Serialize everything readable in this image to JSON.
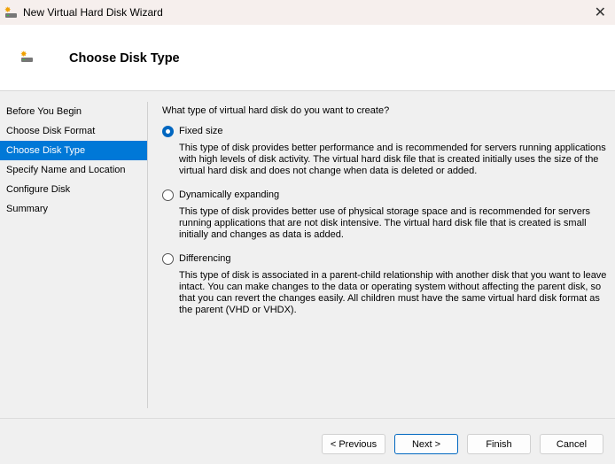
{
  "window": {
    "title": "New Virtual Hard Disk Wizard",
    "close": "✕"
  },
  "header": {
    "title": "Choose Disk Type"
  },
  "nav": {
    "items": [
      "Before You Begin",
      "Choose Disk Format",
      "Choose Disk Type",
      "Specify Name and Location",
      "Configure Disk",
      "Summary"
    ],
    "selected": "Choose Disk Type"
  },
  "main": {
    "question": "What type of virtual hard disk do you want to create?",
    "options": [
      {
        "label": "Fixed size",
        "checked": true,
        "description": "This type of disk provides better performance and is recommended for servers running applications with high levels of disk activity. The virtual hard disk file that is created initially uses the size of the virtual hard disk and does not change when data is deleted or added."
      },
      {
        "label": "Dynamically expanding",
        "checked": false,
        "description": "This type of disk provides better use of physical storage space and is recommended for servers running applications that are not disk intensive. The virtual hard disk file that is created is small initially and changes as data is added."
      },
      {
        "label": "Differencing",
        "checked": false,
        "description": "This type of disk is associated in a parent-child relationship with another disk that you want to leave intact. You can make changes to the data or operating system without affecting the parent disk, so that you can revert the changes easily. All children must have the same virtual hard disk format as the parent (VHD or VHDX)."
      }
    ]
  },
  "buttons": {
    "previous": "< Previous",
    "next": "Next >",
    "finish": "Finish",
    "cancel": "Cancel"
  }
}
